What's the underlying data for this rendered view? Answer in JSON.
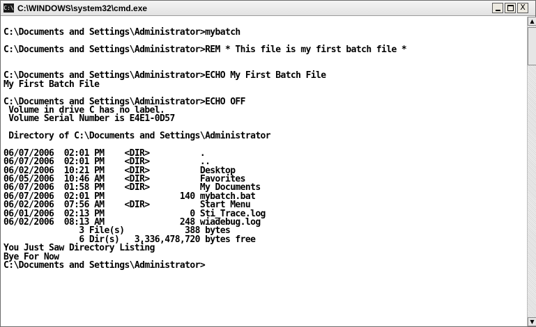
{
  "window": {
    "title": "C:\\WINDOWS\\system32\\cmd.exe",
    "icon_text": "C:\\"
  },
  "console": {
    "lines": [
      "",
      "C:\\Documents and Settings\\Administrator>mybatch",
      "",
      "C:\\Documents and Settings\\Administrator>REM * This file is my first batch file *",
      "",
      "",
      "C:\\Documents and Settings\\Administrator>ECHO My First Batch File",
      "My First Batch File",
      "",
      "C:\\Documents and Settings\\Administrator>ECHO OFF",
      " Volume in drive C has no label.",
      " Volume Serial Number is E4E1-0D57",
      "",
      " Directory of C:\\Documents and Settings\\Administrator",
      "",
      "06/07/2006  02:01 PM    <DIR>          .",
      "06/07/2006  02:01 PM    <DIR>          ..",
      "06/02/2006  10:21 PM    <DIR>          Desktop",
      "06/05/2006  10:46 AM    <DIR>          Favorites",
      "06/07/2006  01:58 PM    <DIR>          My Documents",
      "06/07/2006  02:01 PM               140 mybatch.bat",
      "06/02/2006  07:56 AM    <DIR>          Start Menu",
      "06/01/2006  02:13 PM                 0 Sti_Trace.log",
      "06/02/2006  08:13 AM               248 wiadebug.log",
      "               3 File(s)            388 bytes",
      "               6 Dir(s)   3,336,478,720 bytes free",
      "You Just Saw Directory Listing",
      "Bye For Now",
      "C:\\Documents and Settings\\Administrator>"
    ]
  },
  "controls": {
    "minimize_icon": "minimize-icon",
    "maximize_icon": "maximize-icon",
    "close_label": "X"
  },
  "scrollbar": {
    "up_arrow": "▲",
    "down_arrow": "▼"
  }
}
